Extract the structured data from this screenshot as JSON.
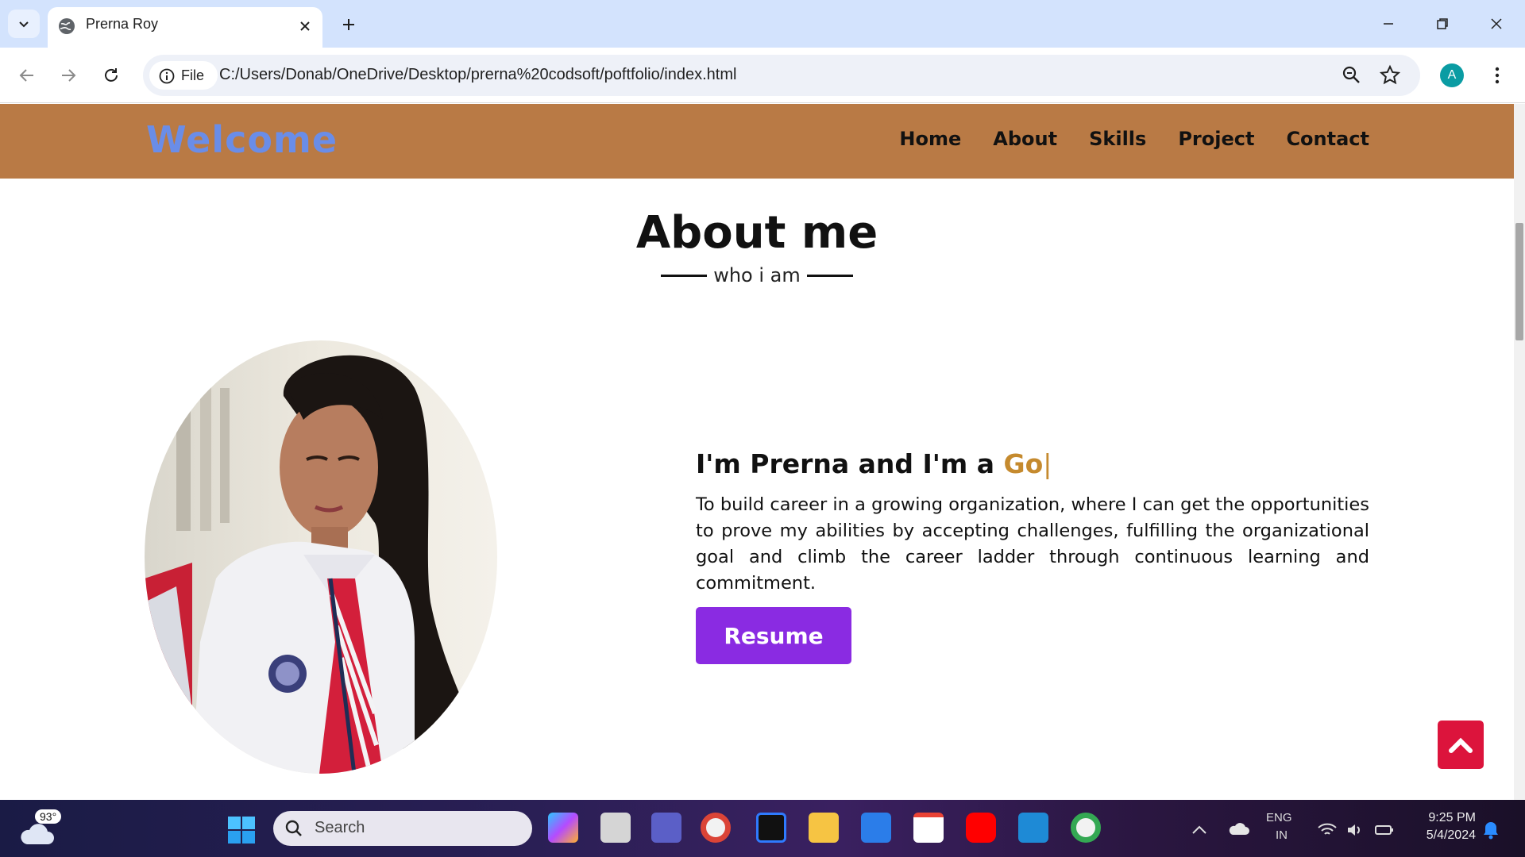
{
  "browser": {
    "tab_title": "Prerna Roy",
    "chip_label": "File",
    "url": "C:/Users/Donab/OneDrive/Desktop/prerna%20codsoft/poftfolio/index.html",
    "profile_initial": "A"
  },
  "site": {
    "brand": "Welcome",
    "nav": [
      "Home",
      "About",
      "Skills",
      "Project",
      "Contact"
    ],
    "section_title": "About me",
    "section_subtitle": "who i am",
    "headline_prefix": "I'm Prerna and I'm a ",
    "headline_typed": "Go",
    "headline_cursor": "|",
    "description": "To build career in a growing organization, where I can get the opportunities to prove my abilities by accepting challenges, fulfilling the organizational goal and climb the career ladder through continuous learning and commitment.",
    "resume_label": "Resume",
    "colors": {
      "nav_bg": "#b97a45",
      "brand": "#6a8de8",
      "accent_typed": "#c58a2e",
      "resume_btn": "#8a2be2",
      "top_btn": "#dc143c"
    }
  },
  "taskbar": {
    "weather_temp": "93°",
    "search_placeholder": "Search",
    "lang_line1": "ENG",
    "lang_line2": "IN",
    "time": "9:25 PM",
    "date": "5/4/2024"
  }
}
